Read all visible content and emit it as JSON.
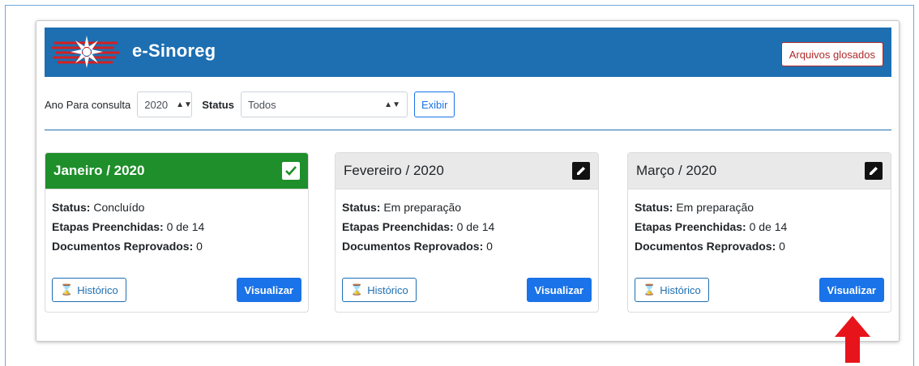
{
  "header": {
    "title": "e-Sinoreg",
    "glosados_label": "Arquivos glosados"
  },
  "filters": {
    "year_label": "Ano Para consulta",
    "year_value": "2020",
    "status_label": "Status",
    "status_value": "Todos",
    "exibir_label": "Exibir"
  },
  "cards": [
    {
      "title": "Janeiro / 2020",
      "state_icon": "check-icon",
      "status_label": "Status:",
      "status_value": "Concluído",
      "etapas_label": "Etapas Preenchidas:",
      "etapas_value": "0 de 14",
      "docs_label": "Documentos Reprovados:",
      "docs_value": "0",
      "historico_label": "Histórico",
      "visualizar_label": "Visualizar"
    },
    {
      "title": "Fevereiro / 2020",
      "state_icon": "edit-icon",
      "status_label": "Status:",
      "status_value": "Em preparação",
      "etapas_label": "Etapas Preenchidas:",
      "etapas_value": "0 de 14",
      "docs_label": "Documentos Reprovados:",
      "docs_value": "0",
      "historico_label": "Histórico",
      "visualizar_label": "Visualizar"
    },
    {
      "title": "Março / 2020",
      "state_icon": "edit-icon",
      "status_label": "Status:",
      "status_value": "Em preparação",
      "etapas_label": "Etapas Preenchidas:",
      "etapas_value": "0 de 14",
      "docs_label": "Documentos Reprovados:",
      "docs_value": "0",
      "historico_label": "Histórico",
      "visualizar_label": "Visualizar"
    }
  ],
  "colors": {
    "header_bg": "#1d6fb2",
    "done_green": "#1e8f2a",
    "primary_blue": "#1a73e8",
    "alert_red": "#b02a2a",
    "annotation_arrow": "#e8141c"
  }
}
